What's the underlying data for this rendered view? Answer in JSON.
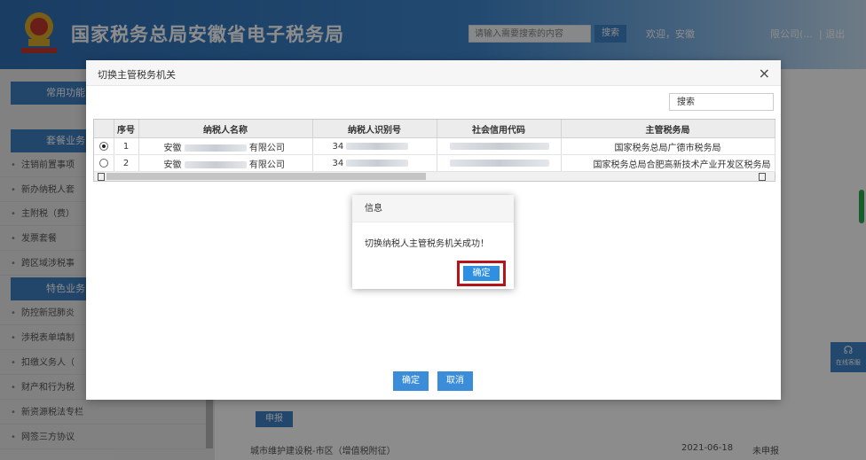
{
  "header": {
    "site_title": "国家税务总局安徽省电子税务局",
    "search_placeholder": "请输入需要搜索的内容",
    "search_button": "搜索",
    "welcome": "欢迎，安徽",
    "company": "限公司(...",
    "logout": "| 退出"
  },
  "sidebar": {
    "categories": [
      "常用功能",
      "套餐业务",
      "特色业务"
    ],
    "items": [
      "注销前置事项",
      "新办纳税人套",
      "主附税（费）",
      "发票套餐",
      "跨区域涉税事",
      "防控新冠肺炎",
      "涉税表单填制",
      "扣缴义务人（",
      "财产和行为税",
      "新资源税法专栏",
      "网签三方协议"
    ]
  },
  "main": {
    "report_button": "申报",
    "bottom_row": {
      "item": "城市维护建设税-市区（增值税附征）",
      "date": "2021-06-18",
      "status": "未申报"
    }
  },
  "float_help": "在线客服",
  "modal": {
    "title": "切换主管税务机关",
    "close": "×",
    "search_button": "搜索",
    "columns": [
      "",
      "序号",
      "纳税人名称",
      "纳税人识别号",
      "社会信用代码",
      "主管税务局"
    ],
    "rows": [
      {
        "selected": true,
        "no": "1",
        "name_left": "安徽",
        "name_right": "有限公司",
        "tax_id": "34",
        "credit": "",
        "bureau": "国家税务总局广德市税务局"
      },
      {
        "selected": false,
        "no": "2",
        "name_left": "安徽",
        "name_right": "有限公司",
        "tax_id": "34",
        "credit": "",
        "bureau": "国家税务总局合肥高新技术产业开发区税务局"
      }
    ],
    "confirm": "确定",
    "cancel": "取消"
  },
  "alert": {
    "title": "信息",
    "message": "切换纳税人主管税务机关成功！",
    "ok": "确定"
  }
}
